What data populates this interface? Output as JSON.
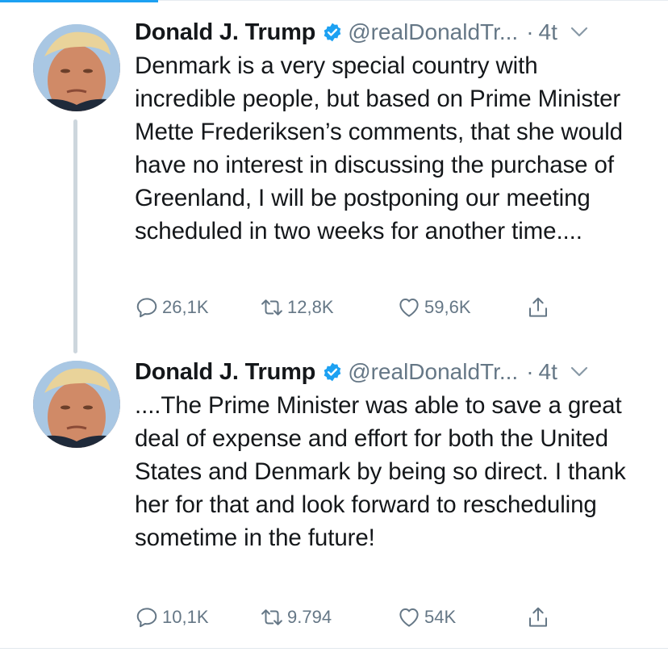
{
  "tweets": [
    {
      "author_name": "Donald J. Trump",
      "handle": "@realDonaldTr...",
      "separator": "·",
      "time": "4t",
      "text": "Denmark is a very special country with incredible people, but based on Prime Minister Mette Frederiksen’s comments, that she would have no interest in discussing the purchase of Greenland, I will be postponing our meeting scheduled in two weeks for another time....",
      "replies": "26,1K",
      "retweets": "12,8K",
      "likes": "59,6K"
    },
    {
      "author_name": "Donald J. Trump",
      "handle": "@realDonaldTr...",
      "separator": "·",
      "time": "4t",
      "text": "....The Prime Minister was able to save a great deal of expense and effort for both the United States and Denmark by being so direct. I thank her for that and look forward to rescheduling sometime in the future!",
      "replies": "10,1K",
      "retweets": "9.794",
      "likes": "54K"
    }
  ],
  "icons": {
    "verified": "verified-badge-icon",
    "caret": "chevron-down-icon",
    "reply": "reply-icon",
    "retweet": "retweet-icon",
    "like": "heart-icon",
    "share": "share-icon"
  },
  "colors": {
    "accent": "#1da1f2",
    "secondary_text": "#657786",
    "thread_line": "#cdd6dd"
  }
}
